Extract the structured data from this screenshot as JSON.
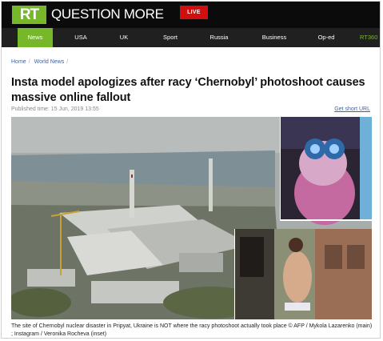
{
  "header": {
    "logo_text": "RT",
    "tagline": "QUESTION MORE",
    "live_label": "LIVE",
    "brand_color": "#77b82a"
  },
  "nav": {
    "items": [
      {
        "label": "News",
        "active": true
      },
      {
        "label": "USA"
      },
      {
        "label": "UK"
      },
      {
        "label": "Sport"
      },
      {
        "label": "Russia"
      },
      {
        "label": "Business"
      },
      {
        "label": "Op-ed"
      },
      {
        "label": "RT360"
      }
    ]
  },
  "breadcrumb": {
    "home": "Home",
    "section": "World News",
    "separator": "/"
  },
  "article": {
    "title": "Insta model apologizes after racy ‘Chernobyl’ photoshoot causes massive online fallout",
    "published": "Published time: 15 Jun, 2019 13:55",
    "short_url_label": "Get short URL",
    "image_caption": "The site of Chernobyl nuclear disaster in Pripyat, Ukraine is NOT where the racy photoshoot actually took place © AFP / Mykola Lazarenko (main) ; Instagram / Veronika Rocheva (inset)"
  }
}
